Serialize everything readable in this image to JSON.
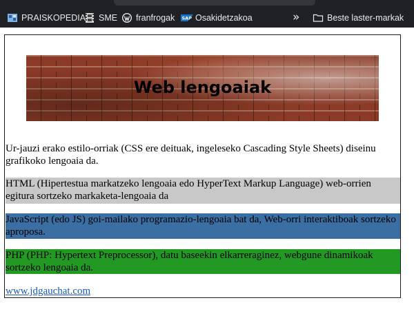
{
  "bookmarks_bar": {
    "items": [
      {
        "label": "PRAISKOPEDIA",
        "icon": "wiki-puzzle-icon"
      },
      {
        "label": "SME",
        "icon": "film-icon"
      },
      {
        "label": "franfrogak",
        "icon": "wordpress-icon"
      },
      {
        "label": "Osakidetzakoa",
        "icon": "sap-icon"
      }
    ],
    "overflow_glyph": "»",
    "folder": {
      "label": "Beste laster-markak",
      "icon": "folder-icon"
    }
  },
  "page": {
    "banner_title": "Web lengoaiak",
    "intro": "Ur-jauzi erako estilo-orriak (CSS ere deituak, ingeleseko Cascading Style Sheets) diseinu grafikoko lengoaia da.",
    "html_para": "HTML (Hipertestua markatzeko lengoaia edo HyperText Markup Language) web-orrien egitura sortzeko markaketa-lengoaia da",
    "js_para": "JavaScript (edo JS) goi-mailako programazio-lengoaia bat da, Web-orri interaktiboak sortzeko aproposa.",
    "php_para": "PHP (PHP: Hypertext Preprocessor), datu baseekin elkarreraginez, webgune dinamikoak sortzeko lengoaia da.",
    "link_text": "www.jdgauchat.com"
  },
  "colors": {
    "html_bg": "#c8c8c8",
    "js_bg": "#3b6ea2",
    "php_bg": "#229922",
    "link": "#1a5ab8"
  }
}
